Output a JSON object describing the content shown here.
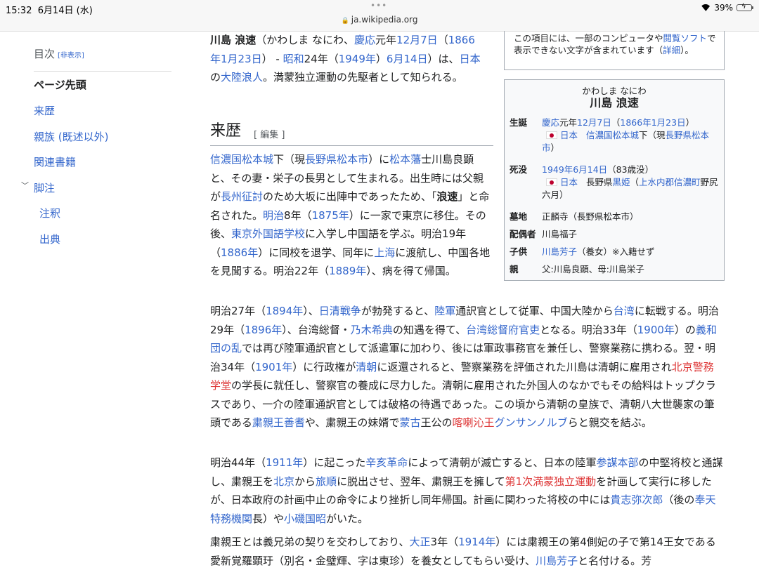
{
  "status": {
    "time": "15:32",
    "date": "6月14日 (水)",
    "url": "ja.wikipedia.org",
    "battery": "39%",
    "battery_level": 0.39
  },
  "toc": {
    "title": "目次",
    "hide": "[非表示]",
    "items": [
      "ページ先頭",
      "来歴",
      "親族 (既述以外)",
      "関連書籍",
      "脚注",
      "注釈",
      "出典"
    ]
  },
  "notice": {
    "t1": "この項目には、一部のコンピュータや",
    "l1": "閲覧ソフト",
    "t2": "で表示できない文字が含まれています（",
    "l2": "詳細",
    "t3": "）。"
  },
  "infobox": {
    "kana": "かわしま なにわ",
    "name": "川島 浪速",
    "labels": {
      "birth": "生誕",
      "death": "死没",
      "grave": "墓地",
      "spouse": "配偶者",
      "children": "子供",
      "parents": "親"
    },
    "birth": {
      "l1": "慶応",
      "t1": "元年",
      "l2": "12月7日",
      "t2": "（",
      "l3": "1866年1月23日",
      "t3": "）",
      "country": "日本",
      "place": "信濃国松本城",
      "t4": "下（現",
      "place2": "長野県松本市",
      "t5": "）"
    },
    "death": {
      "l1": "1949年6月14日",
      "t1": "（83歳没）",
      "country": "日本",
      "t2": "長野県",
      "l2": "黒姫",
      "t3": "（",
      "l3": "上水内郡信濃町",
      "t4": "野尻六月）"
    },
    "grave": "正麟寺（長野県松本市）",
    "spouse": "川島福子",
    "children": {
      "l1": "川島芳子",
      "t1": "（養女）※入籍せず"
    },
    "parents": "父:川島良顕、母:川島栄子"
  },
  "article": {
    "lead": [
      {
        "t": "川島 浪速",
        "b": true
      },
      {
        "t": "（かわしま なにわ、"
      },
      {
        "t": "慶応",
        "k": "link"
      },
      {
        "t": "元年"
      },
      {
        "t": "12月7日",
        "k": "link"
      },
      {
        "t": "（"
      },
      {
        "t": "1866年1月23日",
        "k": "link"
      },
      {
        "t": "） - "
      },
      {
        "t": "昭和",
        "k": "link"
      },
      {
        "t": "24年（"
      },
      {
        "t": "1949年",
        "k": "link"
      },
      {
        "t": "）"
      },
      {
        "t": "6月14日",
        "k": "link"
      },
      {
        "t": "）は、"
      },
      {
        "t": "日本",
        "k": "link"
      },
      {
        "t": "の"
      },
      {
        "t": "大陸浪人",
        "k": "link"
      },
      {
        "t": "。満蒙独立運動の先駆者として知られる。"
      }
    ],
    "section_title": "来歴",
    "edit": "[ 編集 ]",
    "p1": [
      {
        "t": "信濃国",
        "k": "link"
      },
      {
        "t": "松本城",
        "k": "link"
      },
      {
        "t": "下（現"
      },
      {
        "t": "長野県",
        "k": "link"
      },
      {
        "t": "松本市",
        "k": "link"
      },
      {
        "t": "）に"
      },
      {
        "t": "松本藩",
        "k": "link"
      },
      {
        "t": "士川島良顕と、その妻・栄子の長男として生まれる。出生時には父親が"
      },
      {
        "t": "長州征討",
        "k": "link"
      },
      {
        "t": "のため大坂に出陣中であったため、「"
      },
      {
        "t": "浪速",
        "b": true
      },
      {
        "t": "」と命名された。"
      },
      {
        "t": "明治",
        "k": "link"
      },
      {
        "t": "8年（"
      },
      {
        "t": "1875年",
        "k": "link"
      },
      {
        "t": "）に一家で東京に移住。その後、"
      },
      {
        "t": "東京外国語学校",
        "k": "link"
      },
      {
        "t": "に入学し中国語を学ぶ。明治19年（"
      },
      {
        "t": "1886年",
        "k": "link"
      },
      {
        "t": "）に同校を退学、同年に"
      },
      {
        "t": "上海",
        "k": "link"
      },
      {
        "t": "に渡航し、中国各地を見聞する。明治22年（"
      },
      {
        "t": "1889年",
        "k": "link"
      },
      {
        "t": "）、病を得て帰国。"
      }
    ],
    "p2": [
      {
        "t": "明治27年（"
      },
      {
        "t": "1894年",
        "k": "link"
      },
      {
        "t": "）、"
      },
      {
        "t": "日清戦争",
        "k": "link"
      },
      {
        "t": "が勃発すると、"
      },
      {
        "t": "陸軍",
        "k": "link"
      },
      {
        "t": "通訳官として従軍、中国大陸から"
      },
      {
        "t": "台湾",
        "k": "link"
      },
      {
        "t": "に転戦する。明治29年（"
      },
      {
        "t": "1896年",
        "k": "link"
      },
      {
        "t": "）、台湾総督・"
      },
      {
        "t": "乃木希典",
        "k": "link"
      },
      {
        "t": "の知遇を得て、"
      },
      {
        "t": "台湾総督府官吏",
        "k": "link"
      },
      {
        "t": "となる。明治33年（"
      },
      {
        "t": "1900年",
        "k": "link"
      },
      {
        "t": "）の"
      },
      {
        "t": "義和団の乱",
        "k": "link"
      },
      {
        "t": "では再び陸軍通訳官として派遣軍に加わり、後には軍政事務官を兼任し、警察業務に携わる。翌・明治34年（"
      },
      {
        "t": "1901年",
        "k": "link"
      },
      {
        "t": "）に行政権が"
      },
      {
        "t": "清朝",
        "k": "link"
      },
      {
        "t": "に返還されると、警察業務を評価された川島は清朝に雇用され"
      },
      {
        "t": "北京警務学堂",
        "k": "red"
      },
      {
        "t": "の学長に就任し、警察官の養成に尽力した。清朝に雇用された外国人のなかでもその給料はトップクラスであり、一介の陸軍通訳官としては破格の待遇であった。この頃から清朝の皇族で、清朝八大世襲家の筆頭である"
      },
      {
        "t": "粛親王善耆",
        "k": "link"
      },
      {
        "t": "や、粛親王の妹婿で"
      },
      {
        "t": "蒙古",
        "k": "link"
      },
      {
        "t": "王公の"
      },
      {
        "t": "喀喇沁王",
        "k": "red"
      },
      {
        "t": "グンサンノルブ",
        "k": "link"
      },
      {
        "t": "らと親交を結ぶ。"
      }
    ],
    "p3": [
      {
        "t": "明治44年（"
      },
      {
        "t": "1911年",
        "k": "link"
      },
      {
        "t": "）に起こった"
      },
      {
        "t": "辛亥革命",
        "k": "link"
      },
      {
        "t": "によって清朝が滅亡すると、日本の陸軍"
      },
      {
        "t": "参謀本部",
        "k": "link"
      },
      {
        "t": "の中堅将校と通謀し、粛親王を"
      },
      {
        "t": "北京",
        "k": "link"
      },
      {
        "t": "から"
      },
      {
        "t": "旅順",
        "k": "link"
      },
      {
        "t": "に脱出させ、翌年、粛親王を擁して"
      },
      {
        "t": "第1次満蒙独立運動",
        "k": "red"
      },
      {
        "t": "を計画して実行に移したが、日本政府の計画中止の命令により挫折し同年帰国。計画に関わった将校の中には"
      },
      {
        "t": "貴志弥次郎",
        "k": "link"
      },
      {
        "t": "（後の"
      },
      {
        "t": "奉天特務機関",
        "k": "link"
      },
      {
        "t": "長）や"
      },
      {
        "t": "小磯国昭",
        "k": "link"
      },
      {
        "t": "がいた。"
      }
    ],
    "p4": [
      {
        "t": "粛親王とは義兄弟の契りを交わしており、"
      },
      {
        "t": "大正",
        "k": "link"
      },
      {
        "t": "3年（"
      },
      {
        "t": "1914年",
        "k": "link"
      },
      {
        "t": "）には粛親王の第4側妃の子で第14王女である愛新覚羅顕玗（別名・金璧輝、字は東珍）を養女としてもらい受け、"
      },
      {
        "t": "川島芳子",
        "k": "link"
      },
      {
        "t": "と名付ける。芳"
      }
    ]
  }
}
